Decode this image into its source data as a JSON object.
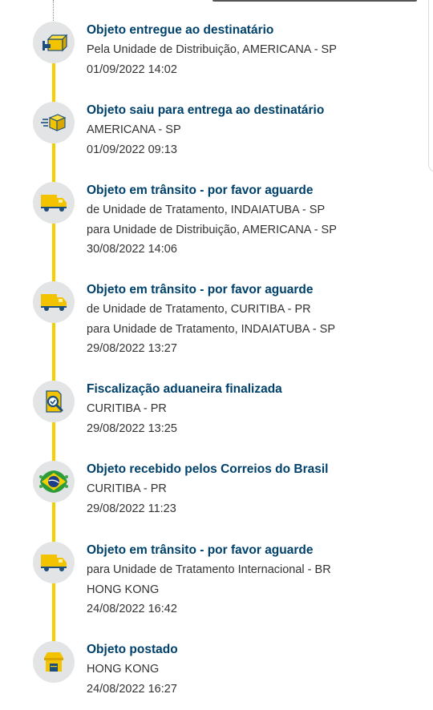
{
  "events": [
    {
      "icon": "delivered-box-icon",
      "title": "Objeto entregue ao destinatário",
      "lines": [
        "Pela Unidade de Distribuição, AMERICANA - SP",
        "01/09/2022 14:02"
      ]
    },
    {
      "icon": "out-for-delivery-box-icon",
      "title": "Objeto saiu para entrega ao destinatário",
      "lines": [
        "AMERICANA - SP",
        "01/09/2022 09:13"
      ]
    },
    {
      "icon": "truck-icon",
      "title": "Objeto em trânsito - por favor aguarde",
      "lines": [
        "de Unidade de Tratamento, INDAIATUBA - SP",
        "para Unidade de Distribuição, AMERICANA - SP",
        "30/08/2022 14:06"
      ]
    },
    {
      "icon": "truck-icon",
      "title": "Objeto em trânsito - por favor aguarde",
      "lines": [
        "de Unidade de Tratamento, CURITIBA - PR",
        "para Unidade de Tratamento, INDAIATUBA - SP",
        "29/08/2022 13:27"
      ]
    },
    {
      "icon": "customs-inspection-icon",
      "title": "Fiscalização aduaneira finalizada",
      "lines": [
        "CURITIBA - PR",
        "29/08/2022 13:25"
      ]
    },
    {
      "icon": "brazil-flag-icon",
      "title": "Objeto recebido pelos Correios do Brasil",
      "lines": [
        "CURITIBA - PR",
        "29/08/2022 11:23"
      ]
    },
    {
      "icon": "truck-icon",
      "title": "Objeto em trânsito - por favor aguarde",
      "lines": [
        "para Unidade de Tratamento Internacional - BR",
        "HONG KONG",
        "24/08/2022 16:42"
      ]
    },
    {
      "icon": "post-office-icon",
      "title": "Objeto postado",
      "lines": [
        "HONG KONG",
        "24/08/2022 16:27"
      ]
    }
  ],
  "colors": {
    "title": "#00416b",
    "accent": "#f4d000",
    "icon_bg": "#e3e4e5"
  }
}
